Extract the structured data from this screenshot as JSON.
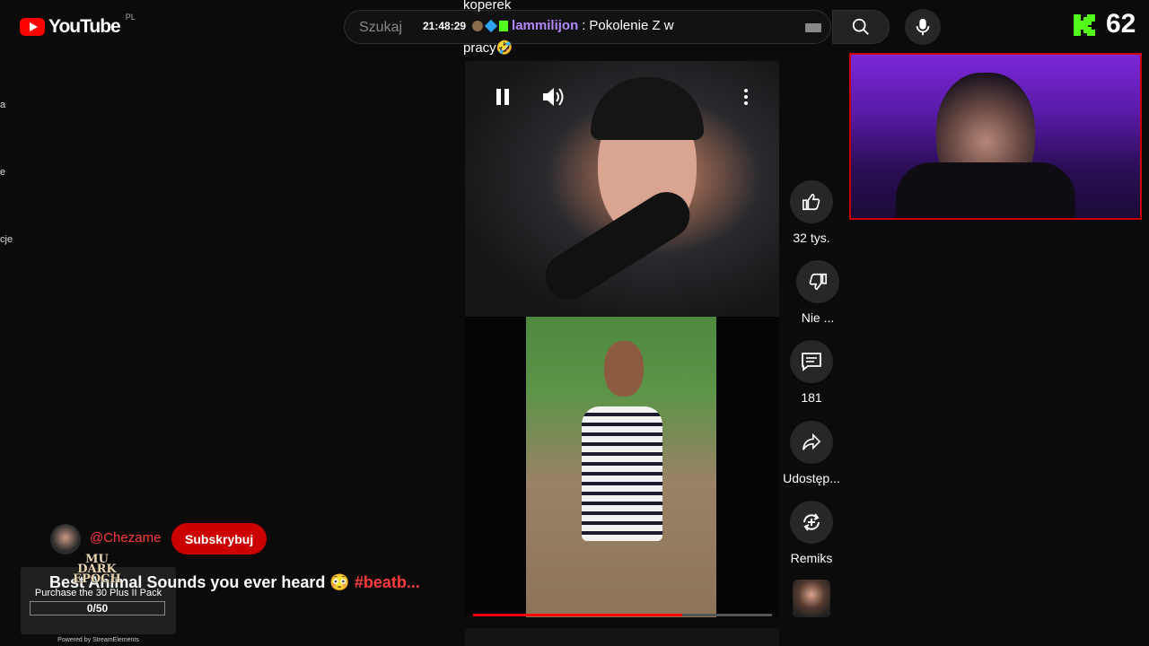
{
  "header": {
    "logo_text": "YouTube",
    "country_code": "PL",
    "search_placeholder": "Szukaj"
  },
  "chat": {
    "previous_message": "koperek",
    "time": "21:48:29",
    "username": "lammilijon",
    "message": "Pokolenie Z w",
    "message_continued": "pracy🤣"
  },
  "kick": {
    "viewer_count": "62",
    "brand_color": "#53fc18"
  },
  "sidebar_fragments": [
    "a",
    "e",
    "cje"
  ],
  "short": {
    "progress_fraction": 0.7,
    "channel_handle": "@Chezame",
    "subscribe_label": "Subskrybuj",
    "title": "Best Animal Sounds you ever heard 😳 ",
    "hashtag": "#beatb..."
  },
  "actions": {
    "like_count": "32 tys.",
    "dislike_label": "Nie ...",
    "comment_count": "181",
    "share_label": "Udostęp...",
    "remix_label": "Remiks"
  },
  "promo": {
    "logo_line1": "MU",
    "logo_line2": "DARK EPOCH",
    "text": "Purchase the 30 Plus II Pack",
    "progress": "0/50",
    "powered_by": "Powered by StreamElements"
  },
  "colors": {
    "accent_red": "#ff0000",
    "username_purple": "#b388ff",
    "handle_red": "#ff3b3b"
  }
}
